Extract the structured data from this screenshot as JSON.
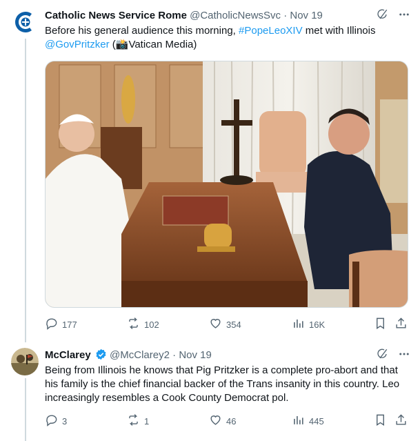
{
  "tweet1": {
    "display_name": "Catholic News Service Rome",
    "handle": "@CatholicNewsSvc",
    "separator": "·",
    "date": "Nov 19",
    "text_part1": "Before his general audience this morning, ",
    "hashtag": "#PopeLeoXIV",
    "text_part2": " met with Illinois ",
    "mention": "@GovPritzker",
    "text_part3": " (",
    "camera_emoji": "📸",
    "text_part4": "Vatican Media)",
    "replies": "177",
    "retweets": "102",
    "likes": "354",
    "views": "16K"
  },
  "tweet2": {
    "display_name": "McClarey",
    "handle": "@McClarey2",
    "separator": "·",
    "date": "Nov 19",
    "text": "Being from Illinois he knows that Pig Pritzker is a complete pro-abort and that his family is the chief financial backer of the Trans insanity in this country.  Leo increasingly resembles a Cook County Democrat pol.",
    "replies": "3",
    "retweets": "1",
    "likes": "46",
    "views": "445"
  },
  "colors": {
    "accent": "#1d9bf0",
    "secondary_text": "#536471",
    "brand_blue": "#0d5fa8"
  },
  "icons": [
    "reply-icon",
    "retweet-icon",
    "like-icon",
    "views-icon",
    "bookmark-icon",
    "share-icon",
    "grok-icon",
    "more-icon",
    "verified-badge-icon"
  ]
}
